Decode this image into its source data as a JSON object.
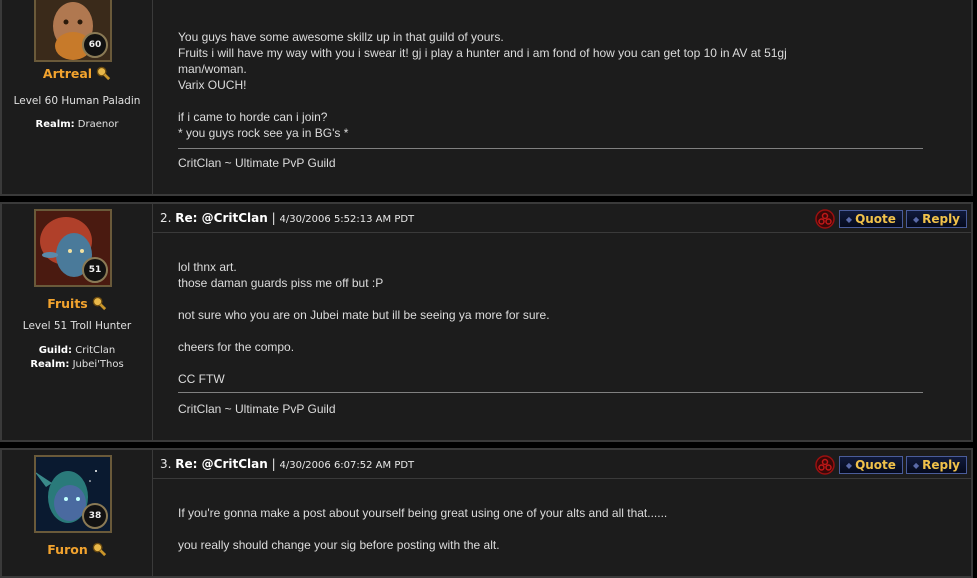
{
  "posts": [
    {
      "user": {
        "name": "Artreal",
        "level_badge": "60",
        "info": "Level 60 Human Paladin",
        "realm_label": "Realm:",
        "realm": "Draenor"
      },
      "body": [
        "You guys have some awesome skillz up in that guild of yours.",
        "Fruits i will have my way with you i swear it! gj i play a hunter and i am fond of how you can get top 10 in AV at 51gj",
        "man/woman.",
        "Varix OUCH!",
        "",
        "if i came to horde can i join?",
        "* you guys rock see ya in BG's *"
      ],
      "signature": "CritClan ~ Ultimate PvP Guild"
    },
    {
      "number": "2.",
      "title": "Re: @CritClan",
      "separator": "|",
      "date": "4/30/2006 5:52:13 AM PDT",
      "quote_label": "Quote",
      "reply_label": "Reply",
      "user": {
        "name": "Fruits",
        "level_badge": "51",
        "info": "Level 51 Troll Hunter",
        "guild_label": "Guild:",
        "guild": "CritClan",
        "realm_label": "Realm:",
        "realm": "Jubei'Thos"
      },
      "body": [
        "lol thnx art.",
        "those daman guards piss me off but :P",
        "",
        "not sure who you are on Jubei mate but ill be seeing ya more for sure.",
        "",
        "cheers for the compo.",
        "",
        "CC FTW"
      ],
      "signature": "CritClan ~ Ultimate PvP Guild"
    },
    {
      "number": "3.",
      "title": "Re: @CritClan",
      "separator": "|",
      "date": "4/30/2006 6:07:52 AM PDT",
      "quote_label": "Quote",
      "reply_label": "Reply",
      "user": {
        "name": "Furon",
        "level_badge": "38"
      },
      "body": [
        "If you're gonna make a post about yourself being great using one of your alts and all that......",
        "",
        "you really should change your sig before posting with the alt."
      ]
    }
  ],
  "colors": {
    "username": "#f2a32e",
    "button_text": "#f0c14a",
    "button_border": "#4a5c9a",
    "report_icon": "#9a1010"
  }
}
